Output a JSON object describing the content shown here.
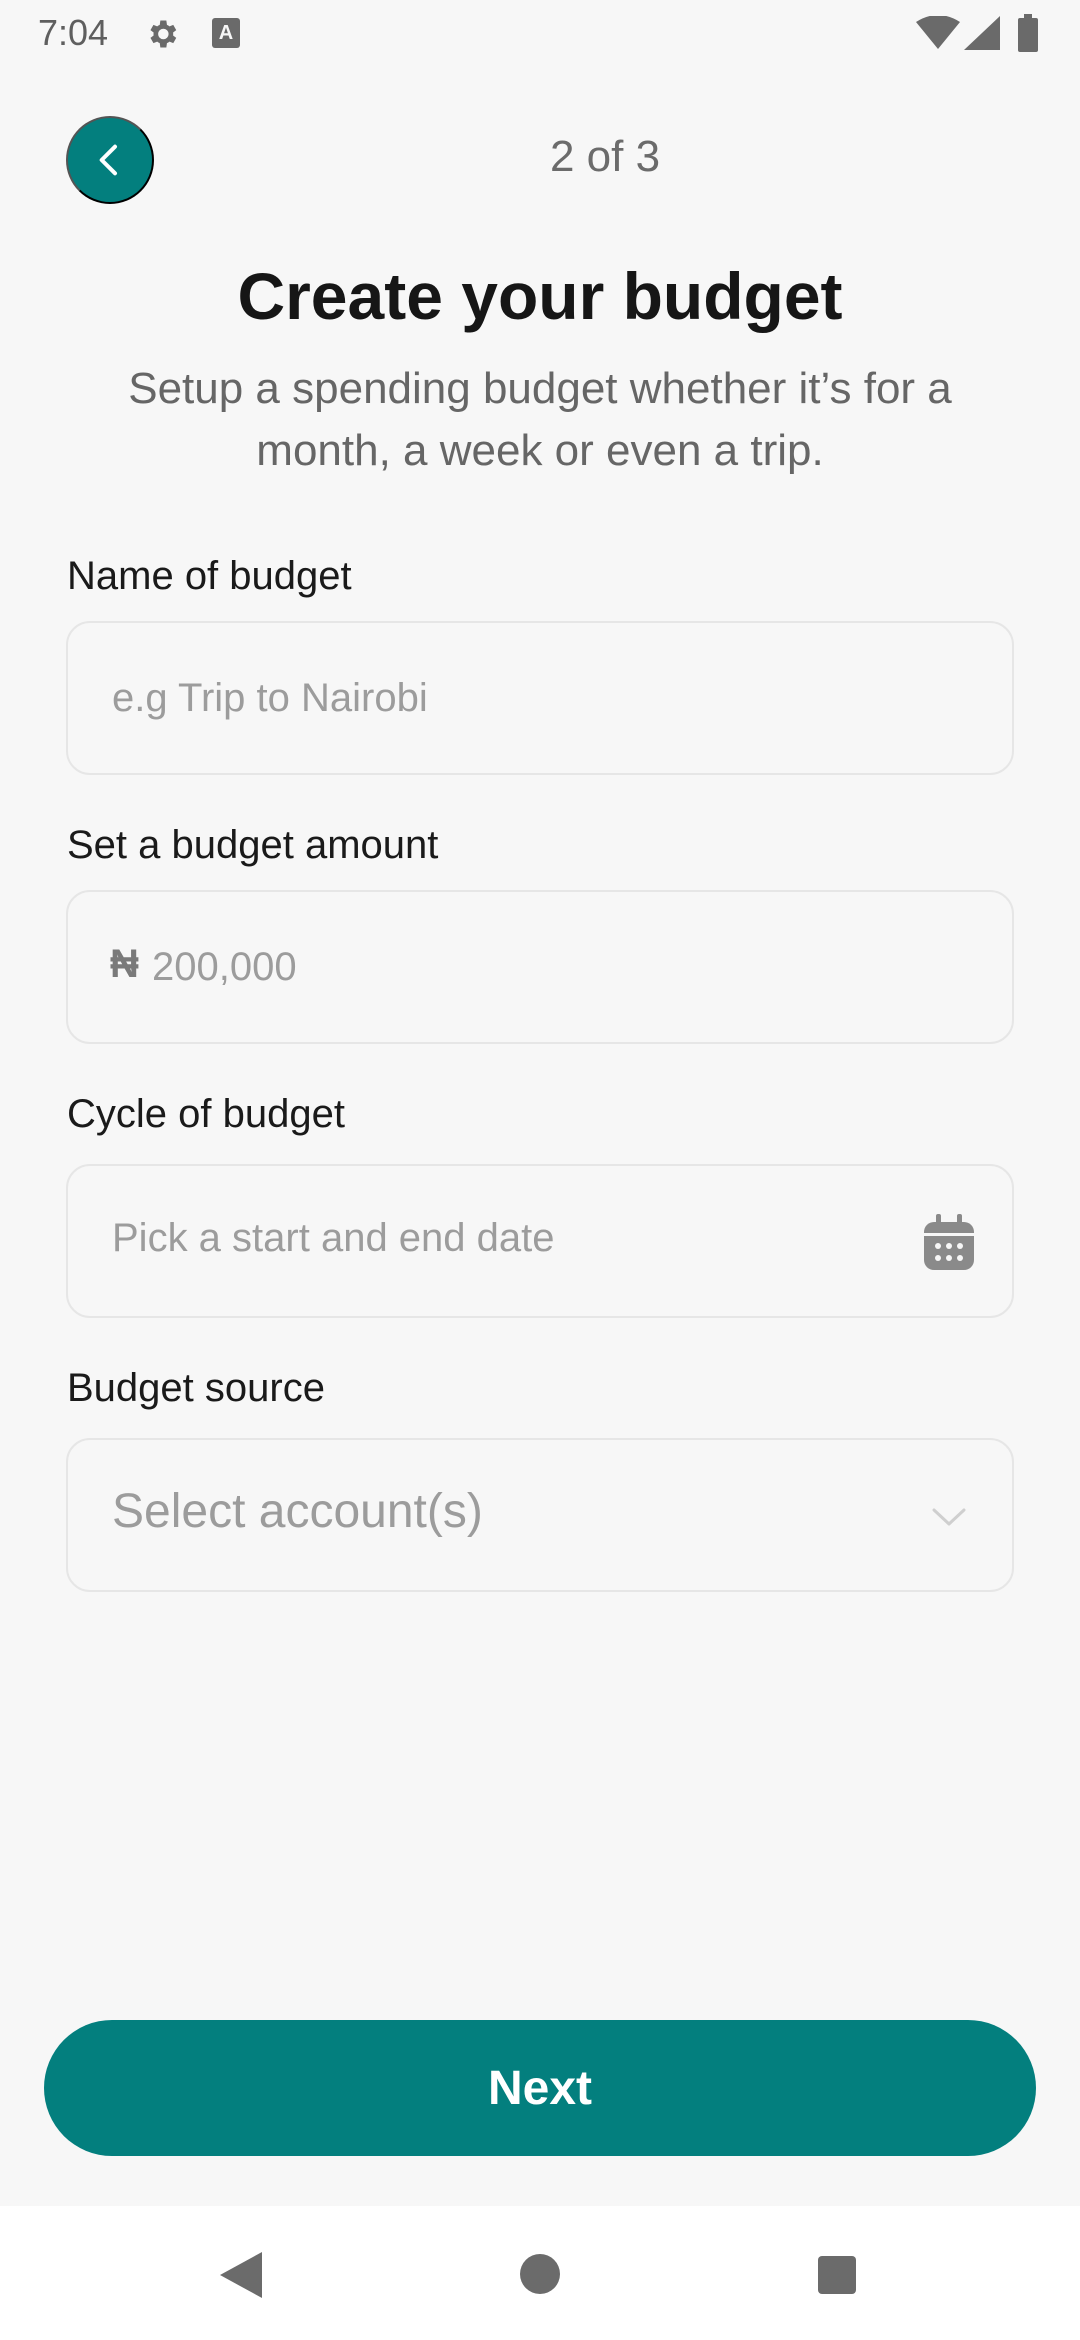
{
  "status_bar": {
    "time": "7:04",
    "keyboard_badge": "A"
  },
  "header": {
    "step": "2 of 3"
  },
  "title": "Create your budget",
  "subtitle": "Setup a spending budget whether it’s for a month, a week or even a trip.",
  "form": {
    "name": {
      "label": "Name of budget",
      "placeholder": "e.g Trip to Nairobi"
    },
    "amount": {
      "label": "Set a budget amount",
      "currency_symbol": "₦",
      "placeholder": "200,000"
    },
    "cycle": {
      "label": "Cycle of budget",
      "placeholder": "Pick a start and end date",
      "icon": "calendar-icon"
    },
    "source": {
      "label": "Budget source",
      "placeholder": "Select account(s)",
      "icon": "chevron-down-icon"
    }
  },
  "next_button": {
    "label": "Next"
  },
  "colors": {
    "accent": "#037f7e",
    "background": "#f7f7f7"
  }
}
